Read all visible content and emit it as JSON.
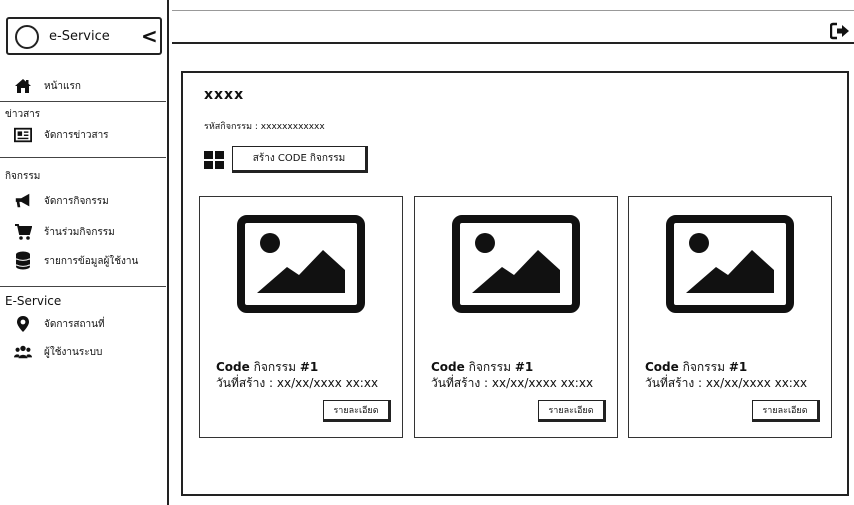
{
  "brand": {
    "name": "e-Service",
    "collapse_glyph": "<"
  },
  "sidebar": {
    "home": {
      "label": "หน้าแรก",
      "icon": "home-icon"
    },
    "news_section": "ข่าวสาร",
    "news_manage": {
      "label": "จัดการข่าวสาร",
      "icon": "newspaper-icon"
    },
    "activity_section": "กิจกรรม",
    "activity_manage": {
      "label": "จัดการกิจกรรม",
      "icon": "megaphone-icon"
    },
    "activity_shops": {
      "label": "ร้านร่วมกิจกรรม",
      "icon": "cart-icon"
    },
    "user_data_list": {
      "label": "รายการข้อมูลผู้ใช้งาน",
      "icon": "database-icon"
    },
    "eservice_section": "E-Service",
    "location_manage": {
      "label": "จัดการสถานที่",
      "icon": "map-marker-icon"
    },
    "system_users": {
      "label": "ผู้ใช้งานระบบ",
      "icon": "users-icon"
    }
  },
  "topbar": {
    "logout_icon": "sign-out-icon"
  },
  "main": {
    "title": "xxxx",
    "activity_code_line": "รหัสกิจกรรม : xxxxxxxxxxxx",
    "create_button": "สร้าง CODE กิจกรรม",
    "cards": [
      {
        "code_prefix": "Code",
        "code_name": "กิจกรรม",
        "code_num": "#1",
        "date_line": "วันที่สร้าง : xx/xx/xxxx xx:xx",
        "detail_button": "รายละเอียด"
      },
      {
        "code_prefix": "Code",
        "code_name": "กิจกรรม",
        "code_num": "#1",
        "date_line": "วันที่สร้าง : xx/xx/xxxx xx:xx",
        "detail_button": "รายละเอียด"
      },
      {
        "code_prefix": "Code",
        "code_name": "กิจกรรม",
        "code_num": "#1",
        "date_line": "วันที่สร้าง : xx/xx/xxxx xx:xx",
        "detail_button": "รายละเอียด"
      }
    ]
  }
}
